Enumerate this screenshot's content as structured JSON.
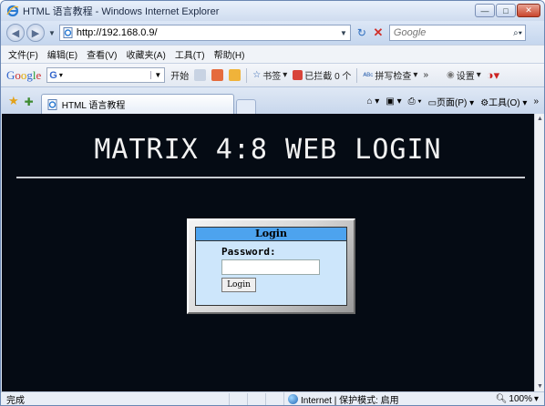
{
  "window": {
    "title": "HTML 语言教程 - Windows Internet Explorer",
    "controls": {
      "minimize": "—",
      "maximize": "□",
      "close": "✕"
    }
  },
  "address_bar": {
    "url": "http://192.168.0.9/",
    "search_placeholder": "Google"
  },
  "menu": [
    "文件(F)",
    "编辑(E)",
    "查看(V)",
    "收藏夹(A)",
    "工具(T)",
    "帮助(H)"
  ],
  "google_toolbar": {
    "logo": [
      "G",
      "o",
      "o",
      "g",
      "l",
      "e"
    ],
    "search_prefix": "G",
    "start": "开始",
    "bookmarks": "书签",
    "blocked": "已拦截 0 个",
    "spellcheck": "拼写检查",
    "more": "»",
    "settings": "设置"
  },
  "tabs": {
    "active_tab": "HTML 语言教程",
    "page_menu": "页面(P)",
    "tools_menu": "工具(O)",
    "more": "»"
  },
  "page": {
    "heading": "MATRIX 4:8 WEB LOGIN",
    "login_title": "Login",
    "password_label": "Password:",
    "password_value": "",
    "login_button": "Login"
  },
  "status_bar": {
    "status": "完成",
    "zone": "Internet | 保护模式: 启用",
    "zoom": "100%"
  },
  "colors": {
    "page_background": "#050b14",
    "login_header": "#4da3ee",
    "login_panel": "#cde6fb"
  }
}
